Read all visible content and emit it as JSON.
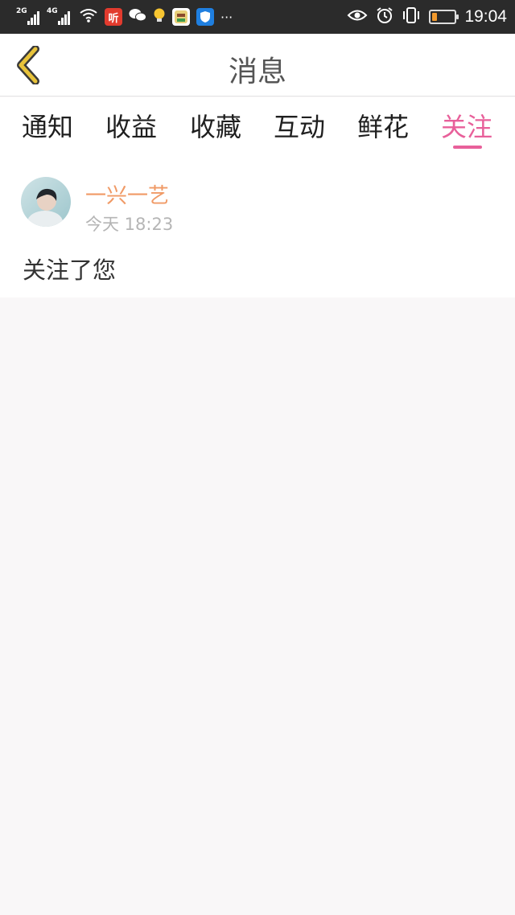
{
  "status_bar": {
    "network_1": "2G",
    "network_2": "4G",
    "app_icon_ting": "听",
    "time": "19:04",
    "more": "···",
    "battery_level": 0.2
  },
  "header": {
    "title": "消息"
  },
  "tabs": [
    {
      "label": "通知"
    },
    {
      "label": "收益"
    },
    {
      "label": "收藏"
    },
    {
      "label": "互动"
    },
    {
      "label": "鲜花"
    },
    {
      "label": "关注",
      "active": true
    }
  ],
  "message": {
    "sender": "一兴一艺",
    "time": "今天 18:23",
    "text": "关注了您"
  },
  "colors": {
    "accent": "#e8609a",
    "sender_name": "#f09a66",
    "back_arrow": "#e8c33a",
    "background": "#f9f7f8"
  }
}
